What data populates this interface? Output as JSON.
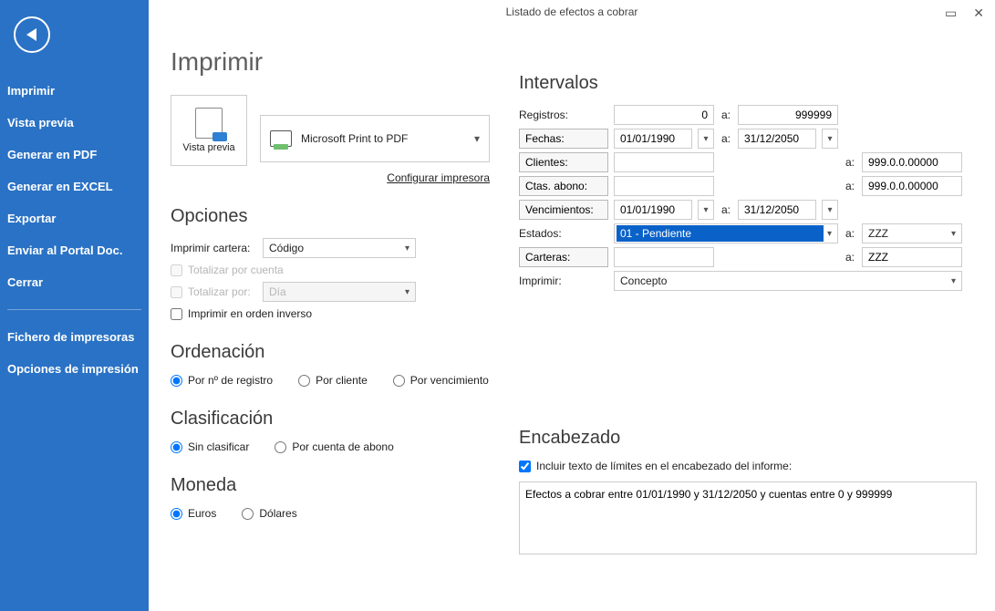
{
  "window": {
    "title": "Listado de efectos a cobrar"
  },
  "sidebar": {
    "items": [
      "Imprimir",
      "Vista previa",
      "Generar en PDF",
      "Generar en EXCEL",
      "Exportar",
      "Enviar al Portal Doc.",
      "Cerrar"
    ],
    "secondary": [
      "Fichero de impresoras",
      "Opciones de impresión"
    ]
  },
  "page_title": "Imprimir",
  "preview_label": "Vista previa",
  "printer_selected": "Microsoft Print to PDF",
  "config_printer": "Configurar impresora",
  "sections": {
    "opciones": "Opciones",
    "ordenacion": "Ordenación",
    "clasificacion": "Clasificación",
    "moneda": "Moneda",
    "intervalos": "Intervalos",
    "encabezado": "Encabezado"
  },
  "opciones": {
    "imprimir_cartera_lbl": "Imprimir cartera:",
    "imprimir_cartera_val": "Código",
    "totalizar_cuenta": "Totalizar por cuenta",
    "totalizar_por": "Totalizar por:",
    "totalizar_por_val": "Día",
    "inverso": "Imprimir en orden inverso"
  },
  "ordenacion": {
    "r1": "Por nº de registro",
    "r2": "Por cliente",
    "r3": "Por vencimiento"
  },
  "clasificacion": {
    "r1": "Sin clasificar",
    "r2": "Por cuenta de abono"
  },
  "moneda": {
    "r1": "Euros",
    "r2": "Dólares"
  },
  "intervalos": {
    "registros_lbl": "Registros:",
    "registros_from": "0",
    "registros_to": "999999",
    "fechas_lbl": "Fechas:",
    "fechas_from": "01/01/1990",
    "fechas_to": "31/12/2050",
    "clientes_lbl": "Clientes:",
    "clientes_to": "999.0.0.00000",
    "ctas_lbl": "Ctas. abono:",
    "ctas_to": "999.0.0.00000",
    "venc_lbl": "Vencimientos:",
    "venc_from": "01/01/1990",
    "venc_to": "31/12/2050",
    "estados_lbl": "Estados:",
    "estados_from": "01 - Pendiente",
    "estados_to": "ZZZ",
    "carteras_lbl": "Carteras:",
    "carteras_to": "ZZZ",
    "imprimir_lbl": "Imprimir:",
    "imprimir_val": "Concepto",
    "a": "a:"
  },
  "encabezado": {
    "chk": "Incluir texto de límites en el encabezado del informe:",
    "text": "Efectos a cobrar entre 01/01/1990 y 31/12/2050 y cuentas entre 0 y 999999"
  }
}
